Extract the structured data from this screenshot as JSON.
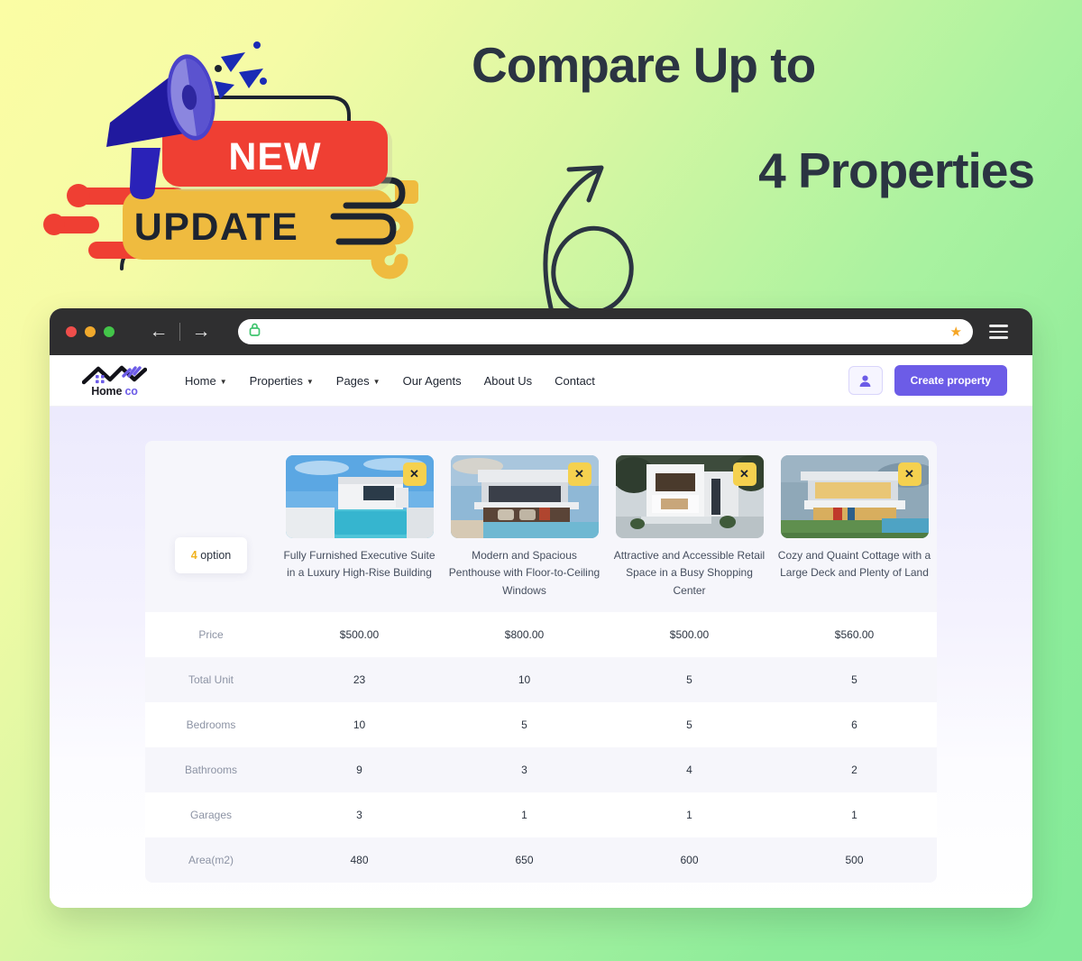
{
  "promo": {
    "badge_new": "NEW",
    "badge_update": "UPDATE",
    "headline_line1": "Compare Up to",
    "headline_line2": "4 Properties",
    "megaphone_icon": "megaphone-icon",
    "arrow_icon": "curly-arrow-icon"
  },
  "browser": {
    "back_icon": "←",
    "forward_icon": "→",
    "lock_icon": "lock-icon",
    "star_icon": "★",
    "menu_icon": "hamburger-icon",
    "address_value": "",
    "address_placeholder": ""
  },
  "site": {
    "logo_text_main": "Home",
    "logo_text_accent": "co",
    "menu": [
      {
        "label": "Home",
        "has_caret": true
      },
      {
        "label": "Properties",
        "has_caret": true
      },
      {
        "label": "Pages",
        "has_caret": true
      },
      {
        "label": "Our Agents",
        "has_caret": false
      },
      {
        "label": "About Us",
        "has_caret": false
      },
      {
        "label": "Contact",
        "has_caret": false
      }
    ],
    "user_icon": "user-icon",
    "create_button": "Create property"
  },
  "compare": {
    "option_count": "4",
    "option_label": "option",
    "close_label": "✕",
    "properties": [
      {
        "title": "Fully Furnished Executive Suite in a Luxury High-Rise Building"
      },
      {
        "title": "Modern and Spacious Penthouse with Floor-to-Ceiling Windows"
      },
      {
        "title": "Attractive and Accessible Retail Space in a Busy Shopping Center"
      },
      {
        "title": "Cozy and Quaint Cottage with a Large Deck and Plenty of Land"
      }
    ],
    "rows": [
      {
        "label": "Price",
        "values": [
          "$500.00",
          "$800.00",
          "$500.00",
          "$560.00"
        ]
      },
      {
        "label": "Total Unit",
        "values": [
          "23",
          "10",
          "5",
          "5"
        ]
      },
      {
        "label": "Bedrooms",
        "values": [
          "10",
          "5",
          "5",
          "6"
        ]
      },
      {
        "label": "Bathrooms",
        "values": [
          "9",
          "3",
          "4",
          "2"
        ]
      },
      {
        "label": "Garages",
        "values": [
          "3",
          "1",
          "1",
          "1"
        ]
      },
      {
        "label": "Area(m2)",
        "values": [
          "480",
          "650",
          "600",
          "500"
        ]
      }
    ]
  },
  "colors": {
    "accent_purple": "#6c5ce7",
    "badge_red": "#ef3f33",
    "badge_yellow": "#efbb3f",
    "close_yellow": "#f5d14f",
    "headline_dark": "#2b3442"
  }
}
